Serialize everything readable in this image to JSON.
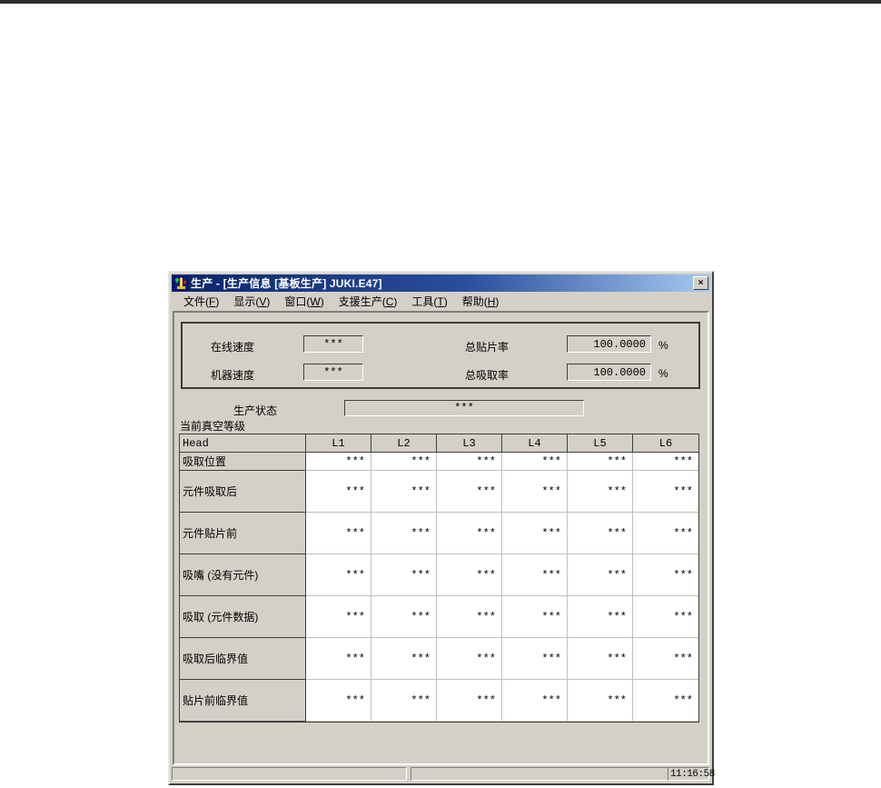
{
  "window": {
    "title": "生产 - [生产信息 [基板生产] JUKI.E47]",
    "close_glyph": "×"
  },
  "menu": {
    "items": [
      {
        "text": "文件",
        "accel": "F"
      },
      {
        "text": "显示",
        "accel": "V"
      },
      {
        "text": "窗口",
        "accel": "W"
      },
      {
        "text": "支援生产",
        "accel": "C"
      },
      {
        "text": "工具",
        "accel": "T"
      },
      {
        "text": "帮助",
        "accel": "H"
      }
    ]
  },
  "metrics": {
    "online_speed": {
      "label": "在线速度",
      "value": "***"
    },
    "machine_speed": {
      "label": "机器速度",
      "value": "***"
    },
    "total_place_rate": {
      "label": "总贴片率",
      "value": "100.0000",
      "unit": "%"
    },
    "total_pick_rate": {
      "label": "总吸取率",
      "value": "100.0000",
      "unit": "%"
    }
  },
  "production_status": {
    "label": "生产状态",
    "value": "***"
  },
  "vacuum_caption": "当前真空等级",
  "table": {
    "columns": [
      "Head",
      "L1",
      "L2",
      "L3",
      "L4",
      "L5",
      "L6"
    ],
    "rows": [
      {
        "label": "吸取位置",
        "values": [
          "***",
          "***",
          "***",
          "***",
          "***",
          "***"
        ]
      },
      {
        "label": "元件吸取后",
        "values": [
          "***",
          "***",
          "***",
          "***",
          "***",
          "***"
        ]
      },
      {
        "label": "元件贴片前",
        "values": [
          "***",
          "***",
          "***",
          "***",
          "***",
          "***"
        ]
      },
      {
        "label": "吸嘴 (没有元件)",
        "values": [
          "***",
          "***",
          "***",
          "***",
          "***",
          "***"
        ]
      },
      {
        "label": "吸取 (元件数据)",
        "values": [
          "***",
          "***",
          "***",
          "***",
          "***",
          "***"
        ]
      },
      {
        "label": "吸取后临界值",
        "values": [
          "***",
          "***",
          "***",
          "***",
          "***",
          "***"
        ]
      },
      {
        "label": "贴片前临界值",
        "values": [
          "***",
          "***",
          "***",
          "***",
          "***",
          "***"
        ]
      }
    ]
  },
  "statusbar": {
    "time": "11:16:58"
  },
  "colors": {
    "titlebar_left": "#0a246a",
    "titlebar_right": "#a6caf0",
    "face": "#d4d0c8",
    "cell_bg": "#ffffff"
  }
}
